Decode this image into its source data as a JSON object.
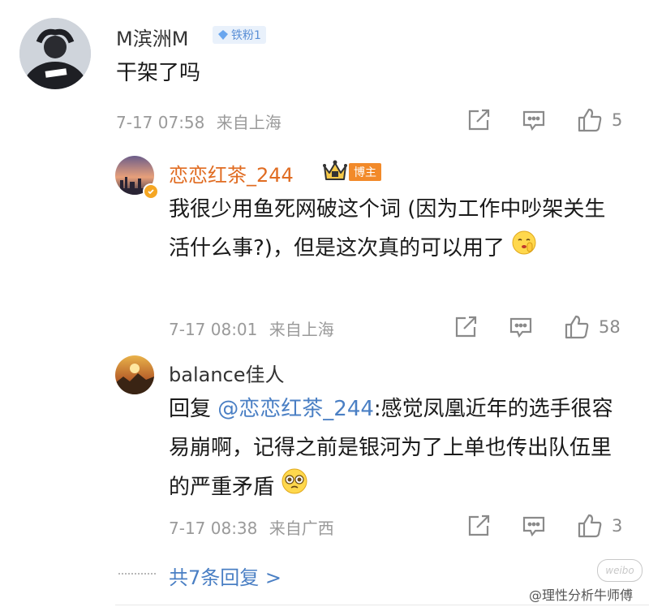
{
  "comment": {
    "user_name": "M滨洲M",
    "fan_badge": "铁粉1",
    "text": "干架了吗",
    "time": "7-17 07:58",
    "location": "来自上海",
    "likes": "5"
  },
  "replies": [
    {
      "user_name": "恋恋红茶_244",
      "role_badge": "博主",
      "text": "我很少用鱼死网破这个词 (因为工作中吵架关生活什么事?)，但是这次真的可以用了",
      "emoji": "shushing-face",
      "time": "7-17 08:01",
      "location": "来自上海",
      "likes": "58"
    },
    {
      "user_name": "balance佳人",
      "reply_prefix": "回复",
      "mention": "@恋恋红茶_244",
      "text": ":感觉凤凰近年的选手很容易崩啊，记得之前是银河为了上单也传出队伍里的严重矛盾",
      "emoji": "pleading-face",
      "time": "7-17 08:38",
      "location": "来自广西",
      "likes": "3"
    }
  ],
  "more_replies": "共7条回复 >",
  "watermark": {
    "logo_text": "weibo",
    "handle": "@理性分析牛师傅"
  },
  "colors": {
    "host_name": "#e06c22",
    "link": "#4a7fc4",
    "meta": "#9a9a9a"
  }
}
